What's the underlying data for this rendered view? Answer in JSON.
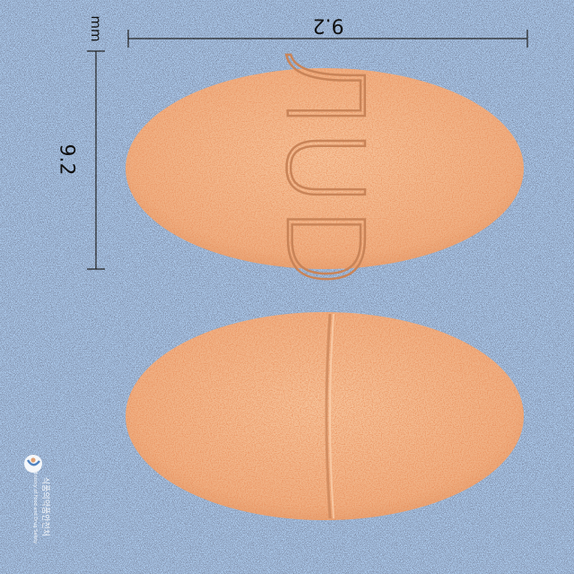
{
  "image": {
    "background_color": "#a9c6e8",
    "tablet_color": "#f2b487",
    "tablet_speckle_color": "#e88a55",
    "imprint_color": "#c98458",
    "tablet_front_imprint": "ЛUD",
    "tablet_back_feature": "score-line"
  },
  "measurements": {
    "unit": "mm",
    "width_value": "9.2",
    "height_value": "9.2"
  },
  "watermark": {
    "logo_icon": "pharmacopoeia-logo-icon",
    "text_line_1": "식품의약품안전처",
    "text_line_2": "Ministry of Food and Drug Safety"
  }
}
